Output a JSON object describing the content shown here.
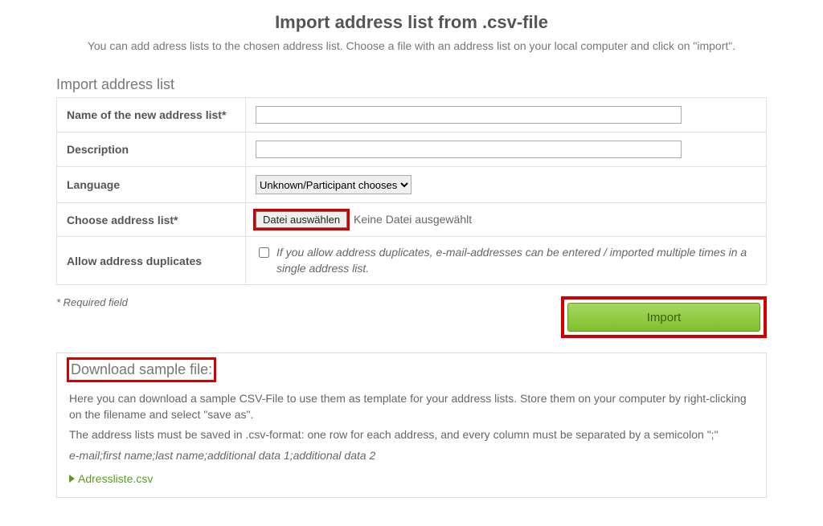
{
  "header": {
    "title": "Import address list from .csv-file",
    "subtitle": "You can add adress lists to the chosen address list. Choose a file with an address list on your local computer and click on \"import\"."
  },
  "form": {
    "section_label": "Import address list",
    "rows": {
      "name": {
        "label": "Name of the new address list*",
        "value": ""
      },
      "description": {
        "label": "Description",
        "value": ""
      },
      "language": {
        "label": "Language",
        "selected": "Unknown/Participant chooses"
      },
      "file": {
        "label": "Choose address list*",
        "button": "Datei auswählen",
        "none_text": "Keine Datei ausgewählt"
      },
      "duplicates": {
        "label": "Allow address duplicates",
        "hint": "If you allow address duplicates, e-mail-addresses can be entered / imported multiple times in a single address list.",
        "checked": false
      }
    },
    "required_note": "* Required field",
    "import_button": "Import"
  },
  "sample": {
    "title": "Download sample file:",
    "p1": "Here you can download a sample CSV-File to use them as template for your address lists. Store them on your computer by right-clicking on the filename and select \"save as\".",
    "p2": "The address lists must be saved in .csv-format: one row for each address, and every column must be separated by a semicolon \";\"",
    "p3": "e-mail;first name;last name;additional data 1;additional data 2",
    "file_link": "Adressliste.csv"
  }
}
